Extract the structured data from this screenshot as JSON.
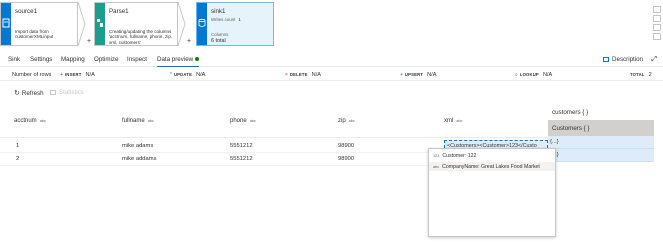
{
  "pipeline": {
    "source": {
      "title": "source1",
      "description": "Import data from customerXMLinput"
    },
    "parse": {
      "title": "Parse1",
      "description": "Creating/updating the columns 'acctnum, fullname, phone, zip, xml, customers'"
    },
    "sink": {
      "title": "sink1",
      "writes_label": "Writes count",
      "writes_value": "1",
      "columns_label": "Columns",
      "columns_total": "6 total"
    },
    "plus_label": "+"
  },
  "tabs": [
    {
      "label": "Sink",
      "active": false
    },
    {
      "label": "Settings",
      "active": false
    },
    {
      "label": "Mapping",
      "active": false
    },
    {
      "label": "Optimize",
      "active": false
    },
    {
      "label": "Inspect",
      "active": false
    },
    {
      "label": "Data preview",
      "active": true
    }
  ],
  "description_button": "Description",
  "stats": {
    "rows_label": "Number of rows",
    "insert_label": "INSERT",
    "insert_value": "N/A",
    "update_label": "UPDATE",
    "update_value": "N/A",
    "delete_label": "DELETE",
    "delete_value": "N/A",
    "upsert_label": "UPSERT",
    "upsert_value": "N/A",
    "lookup_label": "LOOKUP",
    "lookup_value": "N/A",
    "total_label": "TOTAL",
    "total_value": "2"
  },
  "actions": {
    "refresh": "Refresh",
    "statistics": "Statistics"
  },
  "grid": {
    "columns": [
      {
        "name": "acctnum",
        "type": "abc"
      },
      {
        "name": "fullname",
        "type": "abc"
      },
      {
        "name": "phone",
        "type": "abc"
      },
      {
        "name": "zip",
        "type": "abc"
      },
      {
        "name": "xml",
        "type": "abc"
      }
    ],
    "rows": [
      [
        "1",
        "mike adams",
        "5551212",
        "98900",
        "<Customers><Customer>123</Custo"
      ],
      [
        "2",
        "mike addams",
        "5551212",
        "98900",
        ""
      ]
    ],
    "customers_column": {
      "header": "customers",
      "header_glyph": "{ }",
      "selected_header": "Customers",
      "selected_glyph": "{ }",
      "cell_glyph": "{...}"
    }
  },
  "popup": {
    "customer_type": "123",
    "customer_text": "Customer: 122",
    "company_type": "abc",
    "company_text": "CompanyName: Great Lakes Food Market"
  },
  "colors": {
    "accent": "#0078d4",
    "sink_fill": "#e6f3fb",
    "selected_header": "#d2d0ce",
    "preview_dot": "#107c10"
  }
}
